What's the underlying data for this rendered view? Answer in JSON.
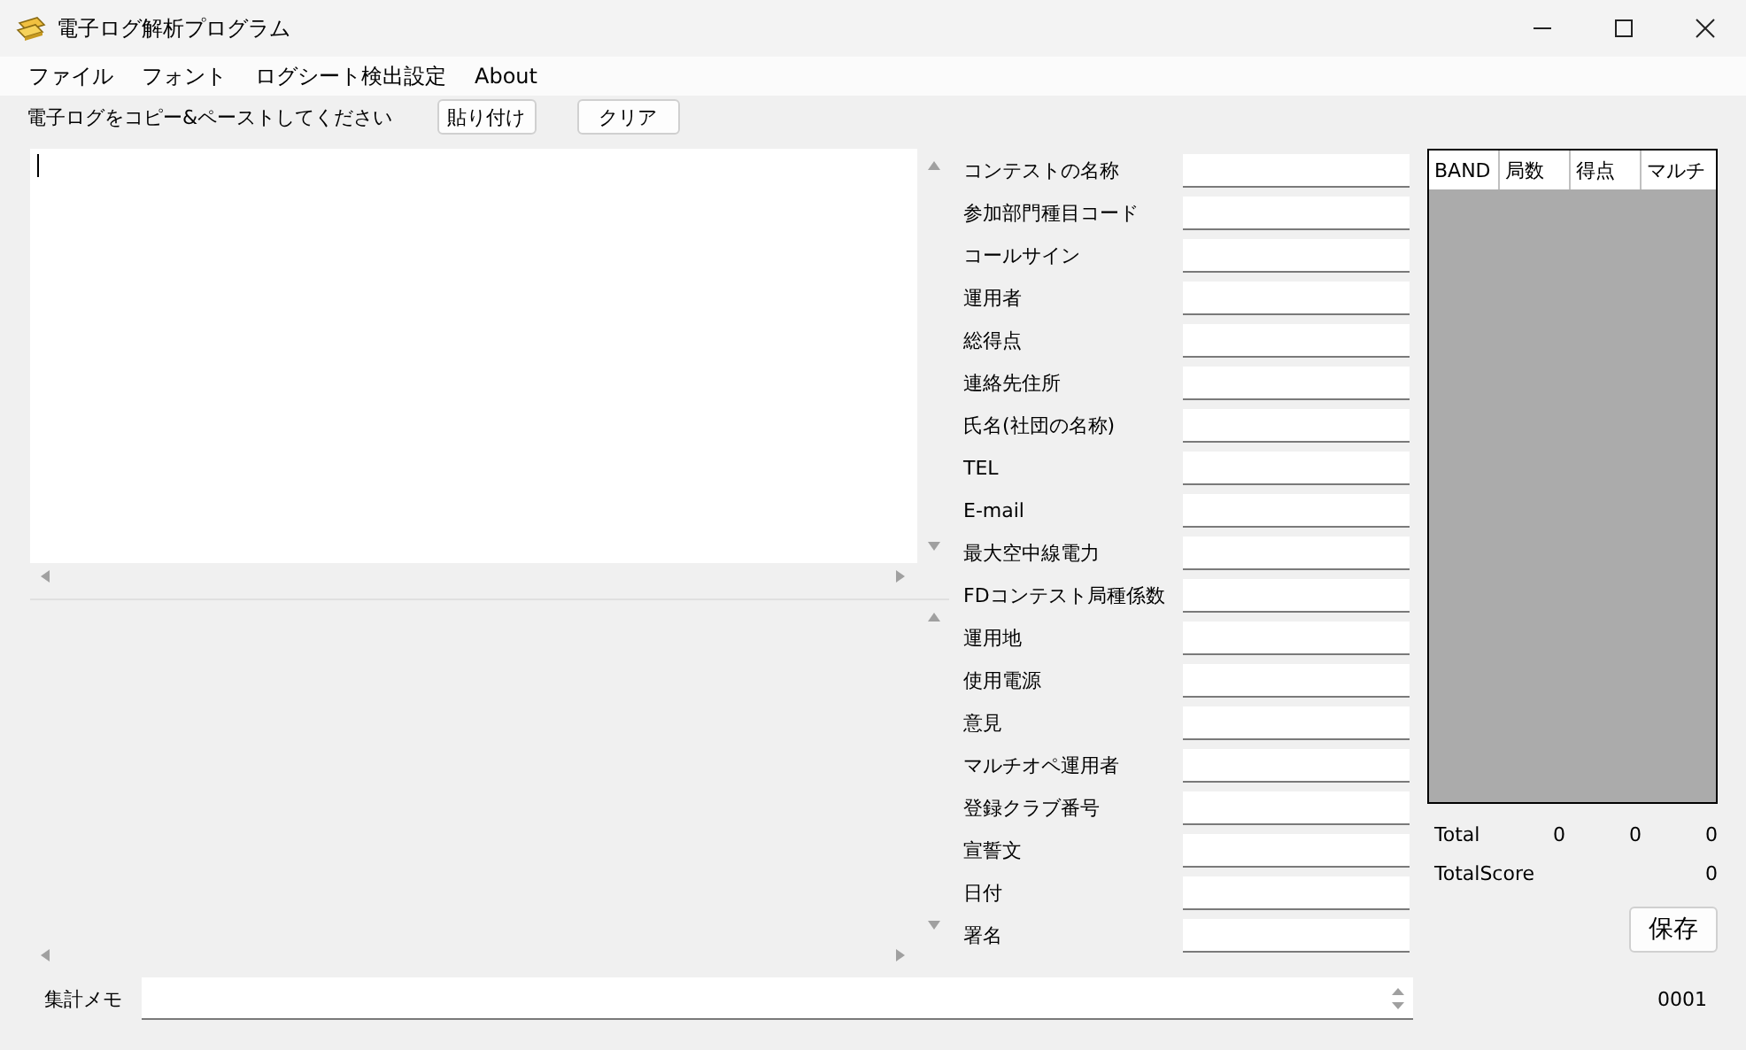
{
  "window": {
    "title": "電子ログ解析プログラム"
  },
  "menu": [
    "ファイル",
    "フォント",
    "ログシート検出設定",
    "About"
  ],
  "toolbar": {
    "instruction": "電子ログをコピー&ペーストしてください",
    "buttons": [
      "貼り付け",
      "クリア"
    ]
  },
  "fields": [
    {
      "label": "コンテストの名称"
    },
    {
      "label": "参加部門種目コード"
    },
    {
      "label": "コールサイン"
    },
    {
      "label": "運用者"
    },
    {
      "label": "総得点"
    },
    {
      "label": "連絡先住所"
    },
    {
      "label": "氏名(社団の名称)"
    },
    {
      "label": "TEL"
    },
    {
      "label": "E-mail"
    },
    {
      "label": "最大空中線電力"
    },
    {
      "label": "FDコンテスト局種係数"
    },
    {
      "label": "運用地"
    },
    {
      "label": "使用電源"
    },
    {
      "label": "意見"
    },
    {
      "label": "マルチオペ運用者"
    },
    {
      "label": "登録クラブ番号"
    },
    {
      "label": "宣誓文"
    },
    {
      "label": "日付"
    },
    {
      "label": "署名"
    }
  ],
  "band_table": {
    "columns": [
      "BAND",
      "局数",
      "得点",
      "マルチ"
    ]
  },
  "totals": {
    "label": "Total",
    "values": [
      "0",
      "0",
      "0"
    ]
  },
  "total_score": {
    "label": "TotalScore",
    "value": "0"
  },
  "save_button": "保存",
  "memo": {
    "label": "集計メモ"
  },
  "counter": "0001"
}
